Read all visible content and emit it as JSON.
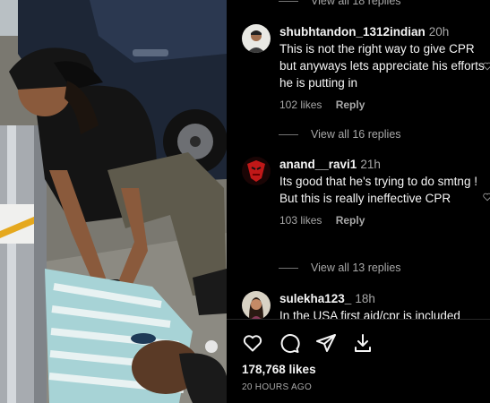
{
  "post": {
    "likes": "178,768 likes",
    "time_ago": "20 HOURS AGO"
  },
  "replies_top": "View all 18 replies",
  "comments": [
    {
      "username": "shubhtandon_1312indian",
      "time": "20h",
      "text": "This is not the right way to give CPR but anyways lets appreciate his efforts he is putting in",
      "likes": "102 likes",
      "reply": "Reply",
      "view_replies": "View all 16 replies"
    },
    {
      "username": "anand__ravi1",
      "time": "21h",
      "text": "Its good that he's trying to do smtng ! But this is really ineffective CPR",
      "likes": "103 likes",
      "reply": "Reply",
      "view_replies": "View all 13 replies"
    },
    {
      "username": "sulekha123_",
      "time": "18h",
      "text": "In the USA first aid/cpr is included"
    }
  ],
  "icons": {
    "like": "heart-icon",
    "comment": "comment-icon",
    "share": "send-icon",
    "save": "save-download-icon",
    "comment_like": "small-heart-icon"
  },
  "colors": {
    "background": "#000000",
    "primary_text": "#f5f5f5",
    "secondary_text": "#a8a8a8"
  }
}
